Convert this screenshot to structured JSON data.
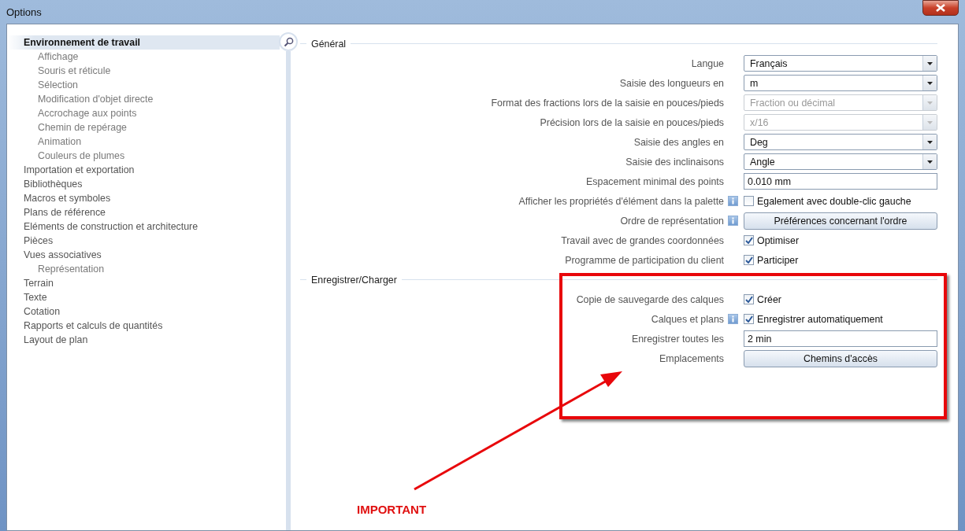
{
  "window": {
    "title": "Options"
  },
  "sidebar": {
    "items": [
      {
        "label": "Environnement de travail",
        "selected": true,
        "children": [
          {
            "label": "Affichage",
            "selected": false
          },
          {
            "label": "Souris et réticule",
            "selected": false
          },
          {
            "label": "Sélection",
            "selected": false
          },
          {
            "label": "Modification d'objet directe",
            "selected": false
          },
          {
            "label": "Accrochage aux points",
            "selected": false
          },
          {
            "label": "Chemin de repérage",
            "selected": false
          },
          {
            "label": "Animation",
            "selected": false
          },
          {
            "label": "Couleurs de plumes",
            "selected": false
          }
        ]
      },
      {
        "label": "Importation et exportation",
        "selected": false
      },
      {
        "label": "Bibliothèques",
        "selected": false
      },
      {
        "label": "Macros et symboles",
        "selected": false
      },
      {
        "label": "Plans de référence",
        "selected": false
      },
      {
        "label": "Eléments de construction et architecture",
        "selected": false
      },
      {
        "label": "Pièces",
        "selected": false
      },
      {
        "label": "Vues associatives",
        "selected": false,
        "children": [
          {
            "label": "Représentation",
            "selected": false
          }
        ]
      },
      {
        "label": "Terrain",
        "selected": false
      },
      {
        "label": "Texte",
        "selected": false
      },
      {
        "label": "Cotation",
        "selected": false
      },
      {
        "label": "Rapports et calculs de quantités",
        "selected": false
      },
      {
        "label": "Layout de plan",
        "selected": false
      }
    ]
  },
  "sections": [
    {
      "title": "Général",
      "rows": [
        {
          "kind": "dropdown",
          "label": "Langue",
          "value": "Français",
          "disabled": false
        },
        {
          "kind": "dropdown",
          "label": "Saisie des longueurs en",
          "value": "m",
          "disabled": false
        },
        {
          "kind": "dropdown",
          "label": "Format des fractions lors de la saisie en pouces/pieds",
          "value": "Fraction ou décimal",
          "disabled": true
        },
        {
          "kind": "dropdown",
          "label": "Précision lors de la saisie en pouces/pieds",
          "value": "x/16",
          "disabled": true
        },
        {
          "kind": "dropdown",
          "label": "Saisie des angles en",
          "value": "Deg",
          "disabled": false
        },
        {
          "kind": "dropdown",
          "label": "Saisie des inclinaisons",
          "value": "Angle",
          "disabled": false
        },
        {
          "kind": "text",
          "label": "Espacement minimal des points",
          "value": "0.010 mm"
        },
        {
          "kind": "checkbox",
          "label": "Afficher les propriétés d'élément dans la palette",
          "info": true,
          "text": "Egalement avec double-clic gauche",
          "checked": false
        },
        {
          "kind": "button",
          "label": "Ordre de représentation",
          "info": true,
          "text": "Préférences concernant l'ordre"
        },
        {
          "kind": "checkbox",
          "label": "Travail avec de grandes coordonnées",
          "text": "Optimiser",
          "checked": true
        },
        {
          "kind": "checkbox",
          "label": "Programme de participation du client",
          "text": "Participer",
          "checked": true
        }
      ]
    },
    {
      "title": "Enregistrer/Charger",
      "rows": [
        {
          "kind": "checkbox",
          "label": "Copie de sauvegarde des calques",
          "text": "Créer",
          "checked": true
        },
        {
          "kind": "checkbox",
          "label": "Calques et plans",
          "info": true,
          "text": "Enregistrer automatiquement",
          "checked": true
        },
        {
          "kind": "text",
          "label": "Enregistrer toutes les",
          "value": "2 min"
        },
        {
          "kind": "button",
          "label": "Emplacements",
          "text": "Chemins d'accès"
        }
      ]
    }
  ],
  "annotation": {
    "label": "IMPORTANT"
  }
}
